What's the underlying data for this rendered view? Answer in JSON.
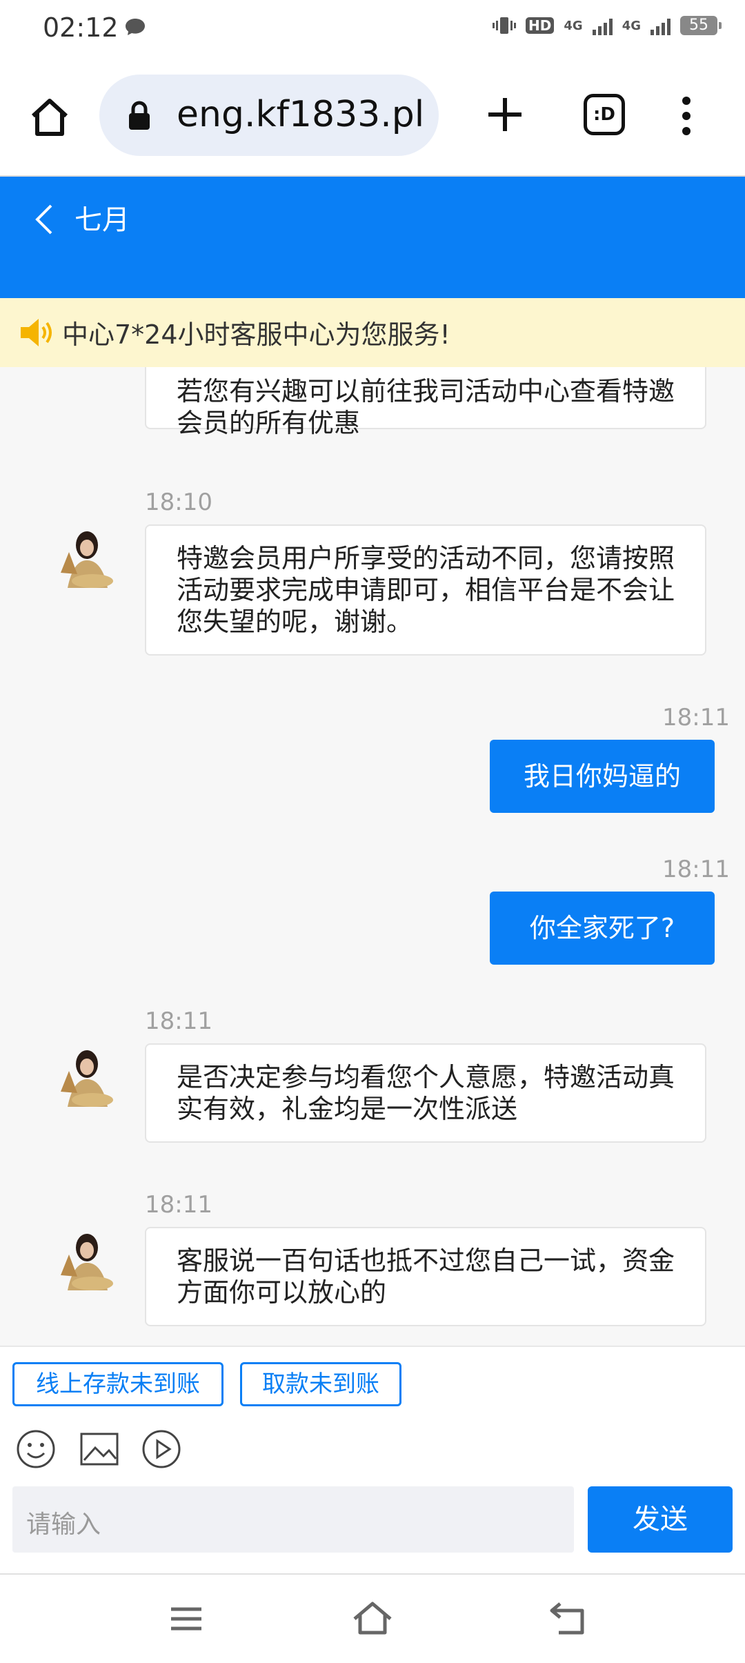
{
  "status_bar": {
    "time": "02:12",
    "hd_label": "HD",
    "network_1": "4G",
    "network_2": "4G",
    "battery": "55"
  },
  "browser": {
    "url": "eng.kf1833.pl",
    "tabs_label": ":D"
  },
  "chat_header": {
    "title": "七月"
  },
  "notice": {
    "text": "中心7*24小时客服中心为您服务!"
  },
  "messages": [
    {
      "side": "in",
      "time": "",
      "text": "若您有兴趣可以前往我司活动中心查看特邀会员的所有优惠"
    },
    {
      "side": "in",
      "time": "18:10",
      "text": "特邀会员用户所享受的活动不同，您请按照活动要求完成申请即可，相信平台是不会让您失望的呢，谢谢。"
    },
    {
      "side": "out",
      "time": "18:11",
      "text": "我日你妈逼的"
    },
    {
      "side": "out",
      "time": "18:11",
      "text": "你全家死了?"
    },
    {
      "side": "in",
      "time": "18:11",
      "text": "是否决定参与均看您个人意愿，特邀活动真实有效，礼金均是一次性派送"
    },
    {
      "side": "in",
      "time": "18:11",
      "text": "客服说一百句话也抵不过您自己一试，资金方面你可以放心的"
    }
  ],
  "composer": {
    "quick_replies": [
      "线上存款未到账",
      "取款未到账"
    ],
    "input_placeholder": "请输入",
    "send_label": "发送"
  },
  "colors": {
    "accent": "#0a7ff5",
    "notice_bg": "#fdf6cf",
    "chat_bg": "#f7f7f7"
  }
}
